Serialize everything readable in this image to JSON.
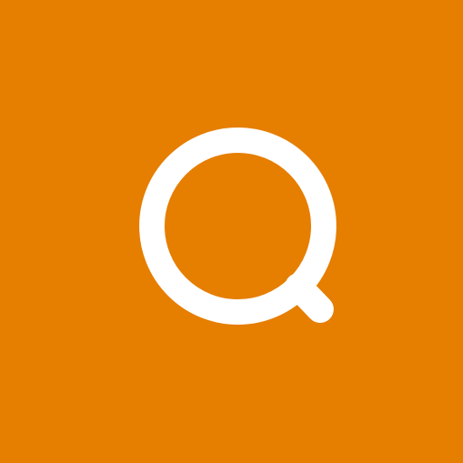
{
  "icon": {
    "name": "search-icon",
    "background_color": "#E67E00",
    "glyph_color": "#FFFFFF"
  }
}
